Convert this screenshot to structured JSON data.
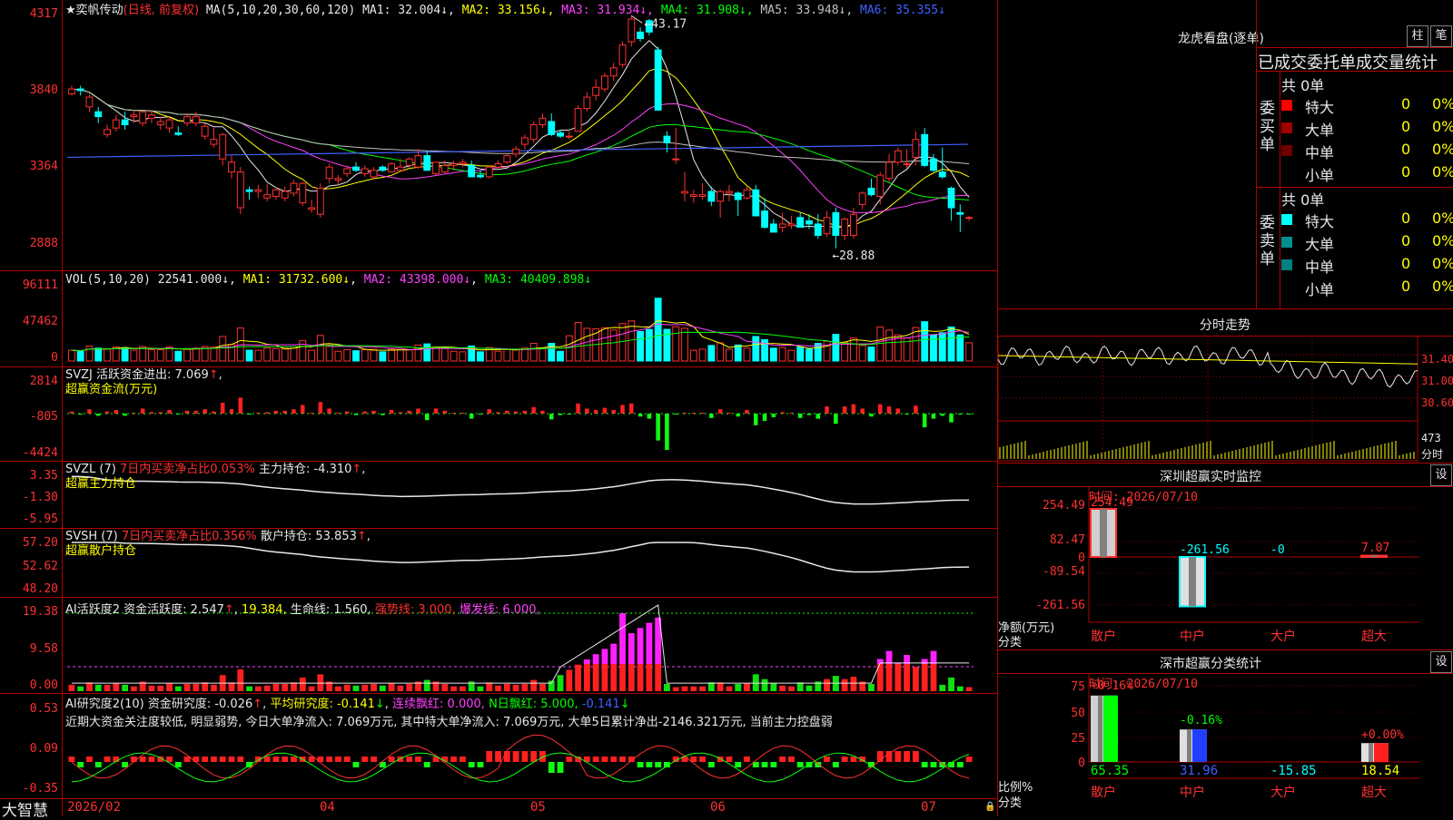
{
  "stock": {
    "name": "★奕帆传动",
    "period": "(日线, 前复权)"
  },
  "ma": {
    "label": "MA(5,10,20,30,60,120)",
    "items": [
      {
        "t": "MA1: 32.004↓",
        "c": "#e8e8e8"
      },
      {
        "t": "MA2: 33.156↓",
        "c": "#ffff00"
      },
      {
        "t": "MA3: 31.934↓",
        "c": "#ff40ff"
      },
      {
        "t": "MA4: 31.908↓",
        "c": "#00ff00"
      },
      {
        "t": "MA5: 33.948↓",
        "c": "#c0c0c0"
      },
      {
        "t": "MA6: 35.355↓",
        "c": "#4060ff"
      }
    ]
  },
  "kline": {
    "yticks": [
      "4317",
      "3840",
      "3364",
      "2888"
    ],
    "high_label": "43.17",
    "low_label": "28.88",
    "candles": [
      [
        38.4,
        38.9,
        38.3,
        38.7
      ],
      [
        38.7,
        38.9,
        38.3,
        38.6
      ],
      [
        37.6,
        38.4,
        37.3,
        38.2
      ],
      [
        37.3,
        37.6,
        36.6,
        37.0
      ],
      [
        35.9,
        36.5,
        35.7,
        36.2
      ],
      [
        36.3,
        37.1,
        36.1,
        36.8
      ],
      [
        36.8,
        37.3,
        36.2,
        36.5
      ],
      [
        37.0,
        37.4,
        36.6,
        37.1
      ],
      [
        36.6,
        37.3,
        36.4,
        37.3
      ],
      [
        36.9,
        37.4,
        36.6,
        37.1
      ],
      [
        36.5,
        37.0,
        36.2,
        36.7
      ],
      [
        36.3,
        37.0,
        36.0,
        36.8
      ],
      [
        36.0,
        36.4,
        35.8,
        35.9
      ],
      [
        36.6,
        37.2,
        36.4,
        37.0
      ],
      [
        36.6,
        37.3,
        36.4,
        37.0
      ],
      [
        35.8,
        36.6,
        35.6,
        36.4
      ],
      [
        35.3,
        36.3,
        35.1,
        35.6
      ],
      [
        34.4,
        36.0,
        34.0,
        35.9
      ],
      [
        33.6,
        34.6,
        33.2,
        34.2
      ],
      [
        31.4,
        33.9,
        31.0,
        33.6
      ],
      [
        32.5,
        32.7,
        31.9,
        32.4
      ],
      [
        32.4,
        32.8,
        32.0,
        32.5
      ],
      [
        32.0,
        32.9,
        31.8,
        32.2
      ],
      [
        32.1,
        32.7,
        31.9,
        32.5
      ],
      [
        32.0,
        32.7,
        31.8,
        32.4
      ],
      [
        32.3,
        33.1,
        32.1,
        32.9
      ],
      [
        31.7,
        33.0,
        31.5,
        32.9
      ],
      [
        31.3,
        31.9,
        31.1,
        31.4
      ],
      [
        31.0,
        32.9,
        30.8,
        32.6
      ],
      [
        33.2,
        34.1,
        32.9,
        33.9
      ],
      [
        33.1,
        33.4,
        32.8,
        33.2
      ],
      [
        33.5,
        34.0,
        33.3,
        33.8
      ],
      [
        33.9,
        34.2,
        33.6,
        33.7
      ],
      [
        33.5,
        34.0,
        33.3,
        33.8
      ],
      [
        33.3,
        33.9,
        33.2,
        33.7
      ],
      [
        33.9,
        34.0,
        33.6,
        33.7
      ],
      [
        33.6,
        34.2,
        33.6,
        34.1
      ],
      [
        33.7,
        34.4,
        33.6,
        33.9
      ],
      [
        34.0,
        34.5,
        33.9,
        34.4
      ],
      [
        33.9,
        35.0,
        33.8,
        34.6
      ],
      [
        34.6,
        34.9,
        33.7,
        33.7
      ],
      [
        33.5,
        34.2,
        33.4,
        34.2
      ],
      [
        33.6,
        34.3,
        33.5,
        34.0
      ],
      [
        34.0,
        34.3,
        33.7,
        34.1
      ],
      [
        34.1,
        34.4,
        33.9,
        34.2
      ],
      [
        34.0,
        34.3,
        33.3,
        33.3
      ],
      [
        33.4,
        33.7,
        33.2,
        33.3
      ],
      [
        33.3,
        34.0,
        33.2,
        33.9
      ],
      [
        33.9,
        34.3,
        33.8,
        34.1
      ],
      [
        34.2,
        34.7,
        34.1,
        34.6
      ],
      [
        34.7,
        35.2,
        34.5,
        35.0
      ],
      [
        35.3,
        35.9,
        35.0,
        35.7
      ],
      [
        35.6,
        36.7,
        35.4,
        36.5
      ],
      [
        36.5,
        37.2,
        36.3,
        36.9
      ],
      [
        36.7,
        37.2,
        35.8,
        35.9
      ],
      [
        36.0,
        36.2,
        35.7,
        35.8
      ],
      [
        35.8,
        36.1,
        35.6,
        35.8
      ],
      [
        36.1,
        37.7,
        36.1,
        37.5
      ],
      [
        37.5,
        38.5,
        37.3,
        38.2
      ],
      [
        38.3,
        39.3,
        38.0,
        38.8
      ],
      [
        38.7,
        39.7,
        38.5,
        39.5
      ],
      [
        39.5,
        40.3,
        39.2,
        40.0
      ],
      [
        40.2,
        41.6,
        40.0,
        41.4
      ],
      [
        41.6,
        43.2,
        41.3,
        43.0
      ],
      [
        42.2,
        42.5,
        41.6,
        41.8
      ],
      [
        42.9,
        43.0,
        42.0,
        42.2
      ],
      [
        41.1,
        41.3,
        37.4,
        37.4
      ],
      [
        35.8,
        36.1,
        34.8,
        35.4
      ],
      [
        34.4,
        36.3,
        34.1,
        34.4
      ],
      [
        32.3,
        33.6,
        31.8,
        32.4
      ],
      [
        32.1,
        32.5,
        31.7,
        32.2
      ],
      [
        32.1,
        32.9,
        31.9,
        32.2
      ],
      [
        32.4,
        32.7,
        31.5,
        31.8
      ],
      [
        31.8,
        32.5,
        30.8,
        32.4
      ],
      [
        32.3,
        32.8,
        31.8,
        32.4
      ],
      [
        32.3,
        32.4,
        30.9,
        31.9
      ],
      [
        32.0,
        32.7,
        31.9,
        32.5
      ],
      [
        32.5,
        32.8,
        30.9,
        30.9
      ],
      [
        31.2,
        32.0,
        30.1,
        30.2
      ],
      [
        30.4,
        30.7,
        29.9,
        29.9
      ],
      [
        30.2,
        31.1,
        29.9,
        30.4
      ],
      [
        30.3,
        30.9,
        30.1,
        30.4
      ],
      [
        30.8,
        31.1,
        30.2,
        30.2
      ],
      [
        30.6,
        31.0,
        30.1,
        30.4
      ],
      [
        30.4,
        31.0,
        29.5,
        29.7
      ],
      [
        29.8,
        31.2,
        29.6,
        30.8
      ],
      [
        31.1,
        31.4,
        28.9,
        29.7
      ],
      [
        29.7,
        30.8,
        29.4,
        30.7
      ],
      [
        29.7,
        31.4,
        29.5,
        31.0
      ],
      [
        31.6,
        32.4,
        31.3,
        32.3
      ],
      [
        32.6,
        33.2,
        32.1,
        32.2
      ],
      [
        32.1,
        33.6,
        31.6,
        33.4
      ],
      [
        33.2,
        34.7,
        33.0,
        34.2
      ],
      [
        34.2,
        35.1,
        34.0,
        34.9
      ],
      [
        34.1,
        35.0,
        33.8,
        34.1
      ],
      [
        34.5,
        36.1,
        34.0,
        35.6
      ],
      [
        35.9,
        36.3,
        33.9,
        34.0
      ],
      [
        34.4,
        34.7,
        33.6,
        33.7
      ],
      [
        33.6,
        35.1,
        33.2,
        33.3
      ],
      [
        32.6,
        32.7,
        30.6,
        31.4
      ],
      [
        31.1,
        31.6,
        29.9,
        31.0
      ],
      [
        30.8,
        30.9,
        30.6,
        30.8
      ]
    ],
    "ymin": 28.0,
    "ymax": 43.5
  },
  "vol": {
    "header": "VOL(5,10,20)",
    "v": "22541.000↓",
    "ma1": "MA1: 31732.600↓",
    "ma2": "MA2: 43398.000↓",
    "ma3": "MA3: 40409.898↓",
    "yticks": [
      "96111",
      "47462",
      "0"
    ]
  },
  "svzj": {
    "header": "SVZJ  活跃资金进出: 7.069",
    "sub": "超赢资金流(万元)",
    "yticks": [
      "2814",
      "-805",
      "-4424"
    ]
  },
  "svzl": {
    "header": "SVZL (7)",
    "red": "7日内买卖净占比0.053%",
    "white": "主力持仓: -4.310",
    "sub": "超赢主力持仓",
    "yticks": [
      "3.35",
      "-1.30",
      "-5.95"
    ]
  },
  "svsh": {
    "header": "SVSH (7)",
    "red": "7日内买卖净占比0.356%",
    "white": "散户持仓: 53.853",
    "sub": "超赢散户持仓",
    "yticks": [
      "57.20",
      "52.62",
      "48.20"
    ]
  },
  "ai2": {
    "header": "AI活跃度2 资金活跃度: 2.547",
    "v1": "19.384,",
    "v2": "生命线: 1.560,",
    "v3": "强势线: 3.000,",
    "v4": "爆发线: 6.000,",
    "yticks": [
      "19.38",
      "9.58",
      "0.00"
    ]
  },
  "ai_res": {
    "header": "AI研究度2(10) 资金研究度: -0.026",
    "avg": "平均研究度: -0.141",
    "lx": "连续飘红: 0.000,",
    "nr": "N日飘红: 5.000,",
    "last": "-0.141",
    "note": "近期大资金关注度较低, 明显弱势, 今日大单净流入: 7.069万元, 其中特大单净流入: 7.069万元, 大单5日累计净出-2146.321万元, 当前主力控盘弱",
    "yticks": [
      "0.53",
      "0.09",
      "-0.35"
    ]
  },
  "xaxis": {
    "labels": [
      "2026/02",
      "04",
      "05",
      "06",
      "07"
    ]
  },
  "bottom_brand": "大智慧",
  "right": {
    "title": "龙虎看盘(逐单)",
    "btn1": "柱",
    "btn2": "笔",
    "subtitle": "已成交委托单成交量统计",
    "buy_side": "委买单",
    "sell_side": "委卖单",
    "buy_total": "共 0单",
    "sell_total": "共 0单",
    "buy_rows": [
      {
        "n": "特大",
        "c": "#ff0000",
        "v": "0",
        "p": "0%"
      },
      {
        "n": "大单",
        "c": "#a00000",
        "v": "0",
        "p": "0%"
      },
      {
        "n": "中单",
        "c": "#700000",
        "v": "0",
        "p": "0%"
      },
      {
        "n": "小单",
        "c": "",
        "v": "0",
        "p": "0%"
      }
    ],
    "sell_rows": [
      {
        "n": "特大",
        "c": "#00ffff",
        "v": "0",
        "p": "0%"
      },
      {
        "n": "大单",
        "c": "#009090",
        "v": "0",
        "p": "0%"
      },
      {
        "n": "中单",
        "c": "#008080",
        "v": "0",
        "p": "0%"
      },
      {
        "n": "小单",
        "c": "",
        "v": "0",
        "p": "0%"
      }
    ],
    "fs_title": "分时走势",
    "fs_yticks": [
      "31.40",
      "31.00",
      "30.60"
    ],
    "fs_vol": "473",
    "fs_unit": "分时",
    "sz_title": "深圳超赢实时监控",
    "set1": "设",
    "sz_date": "时间: 2026/07/10",
    "sz_yticks": [
      "254.49",
      "82.47",
      "0",
      "-89.54",
      "-261.56"
    ],
    "sz_values": {
      "sanhu": "254.49",
      "zhonghu": "-261.56",
      "dahu": "-0",
      "chaoda": "7.07"
    },
    "sz_bars": [
      254.49,
      -261.56,
      0,
      7.07
    ],
    "sz_axis1": "净额(万元)",
    "sz_axis2": "分类",
    "cats": [
      "散户",
      "中户",
      "大户",
      "超大"
    ],
    "cl_title": "深市超赢分类统计",
    "set2": "设",
    "cl_date": "时间: 2026/07/10",
    "cl_yticks": [
      "75",
      "50",
      "25",
      "0"
    ],
    "cl_top": {
      "sanhu": "+0.16%",
      "zhonghu": "-0.16%",
      "chaoda": "+0.00%"
    },
    "cl_bottom": [
      "65.35",
      "31.96",
      "-15.85",
      "18.54"
    ],
    "cl_bars": [
      65.35,
      31.96,
      0,
      18.54
    ],
    "cl_axis1": "比例%",
    "cl_axis2": "分类"
  }
}
